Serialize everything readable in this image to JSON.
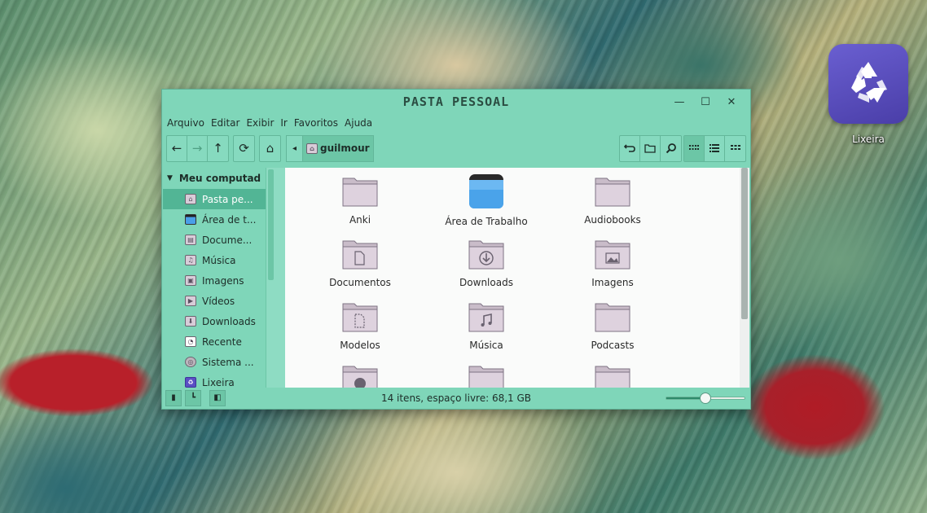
{
  "desktop": {
    "trash_label": "Lixeira"
  },
  "window": {
    "title": "PASTA PESSOAL",
    "controls": {
      "minimize": "—",
      "maximize": "☐",
      "close": "✕"
    }
  },
  "menu": [
    "Arquivo",
    "Editar",
    "Exibir",
    "Ir",
    "Favoritos",
    "Ajuda"
  ],
  "toolbar": {
    "back": "←",
    "forward": "→",
    "up": "↑",
    "reload": "⟳",
    "home": "⌂",
    "path_arrow": "◂",
    "path_segment": "guilmour"
  },
  "sidebar": {
    "header": "Meu computad",
    "items": [
      {
        "label": "Pasta pe...",
        "icon": "home-folder-icon",
        "selected": true
      },
      {
        "label": "Área de t...",
        "icon": "desktop-icon"
      },
      {
        "label": "Docume...",
        "icon": "documents-folder-icon"
      },
      {
        "label": "Música",
        "icon": "music-folder-icon"
      },
      {
        "label": "Imagens",
        "icon": "pictures-folder-icon"
      },
      {
        "label": "Vídeos",
        "icon": "videos-folder-icon"
      },
      {
        "label": "Downloads",
        "icon": "downloads-folder-icon"
      },
      {
        "label": "Recente",
        "icon": "recent-icon"
      },
      {
        "label": "Sistema ...",
        "icon": "filesystem-icon"
      },
      {
        "label": "Lixeira",
        "icon": "trash-icon"
      }
    ]
  },
  "files": [
    {
      "label": "Anki",
      "icon": "folder"
    },
    {
      "label": "Área de Trabalho",
      "icon": "desktop"
    },
    {
      "label": "Audiobooks",
      "icon": "folder"
    },
    {
      "label": "Documentos",
      "icon": "folder-documents"
    },
    {
      "label": "Downloads",
      "icon": "folder-download"
    },
    {
      "label": "Imagens",
      "icon": "folder-pictures"
    },
    {
      "label": "Modelos",
      "icon": "folder-templates"
    },
    {
      "label": "Música",
      "icon": "folder-music"
    },
    {
      "label": "Podcasts",
      "icon": "folder"
    },
    {
      "label": "",
      "icon": "folder-public"
    },
    {
      "label": "",
      "icon": "folder"
    },
    {
      "label": "",
      "icon": "folder"
    }
  ],
  "status": {
    "text": "14 itens, espaço livre: 68,1 GB",
    "zoom_level": 0.5
  }
}
